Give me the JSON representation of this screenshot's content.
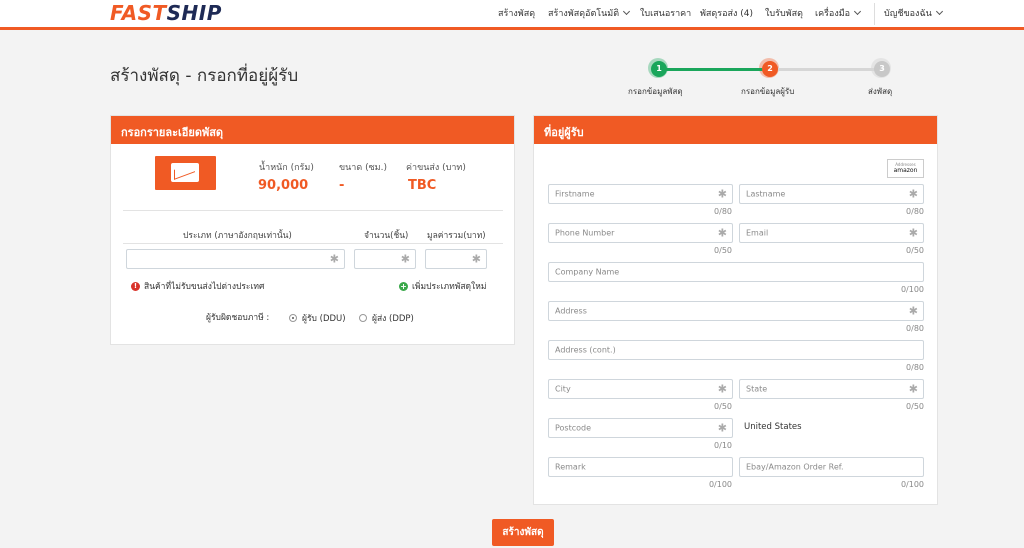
{
  "app": {
    "logo_fast": "FAST",
    "logo_ship": "SHIP"
  },
  "nav": {
    "create": "สร้างพัสดุ",
    "auto_create": "สร้างพัสดุอัตโนมัติ",
    "quotation": "ใบเสนอราคา",
    "to_ship": "พัสดุรอส่ง (4)",
    "receive": "ใบรับพัสดุ",
    "tools": "เครื่องมือ",
    "account": "บัญชีของฉัน"
  },
  "page": {
    "title": "สร้างพัสดุ - กรอกที่อยู่ผู้รับ"
  },
  "stepper": {
    "steps": [
      {
        "number": "1",
        "label": "กรอกข้อมูลพัสดุ",
        "status": "done"
      },
      {
        "number": "2",
        "label": "กรอกข้อมูลผู้รับ",
        "status": "current"
      },
      {
        "number": "3",
        "label": "ส่งพัสดุ",
        "status": "pending"
      }
    ],
    "colors": {
      "done": "#1aa65b",
      "current": "#f05a24",
      "pending": "#c8c8c8"
    }
  },
  "parcel": {
    "header": "กรอกรายละเอียดพัสดุ",
    "weight_label": "น้ำหนัก (กรัม)",
    "weight_value": "90,000",
    "size_label": "ขนาด (ซม.)",
    "size_value": "-",
    "fee_label": "ค่าขนส่ง (บาท)",
    "fee_value": "TBC",
    "col_type": "ประเภท (ภาษาอังกฤษเท่านั้น)",
    "col_qty": "จำนวน(ชิ้น)",
    "col_value": "มูลค่ารวม(บาท)",
    "restricted_note": "สินค้าที่ไม่รับขนส่งไปต่างประเทศ",
    "add_type": "เพิ่มประเภทพัสดุใหม่",
    "duty_label": "ผู้รับผิดชอบภาษี :",
    "duty_options": [
      {
        "label": "ผู้รับ (DDU)",
        "selected": true
      },
      {
        "label": "ผู้ส่ง (DDP)",
        "selected": false
      }
    ]
  },
  "recipient": {
    "header": "ที่อยู่ผู้รับ",
    "amazon_small": "Addresses",
    "amazon_label": "amazon",
    "firstname": {
      "placeholder": "Firstname",
      "counter": "0/80"
    },
    "lastname": {
      "placeholder": "Lastname",
      "counter": "0/80"
    },
    "phone": {
      "placeholder": "Phone Number",
      "counter": "0/50"
    },
    "email": {
      "placeholder": "Email",
      "counter": "0/50"
    },
    "company": {
      "placeholder": "Company Name",
      "counter": "0/100"
    },
    "address": {
      "placeholder": "Address",
      "counter": "0/80"
    },
    "address2": {
      "placeholder": "Address (cont.)",
      "counter": "0/80"
    },
    "city": {
      "placeholder": "City",
      "counter": "0/50"
    },
    "state": {
      "placeholder": "State",
      "counter": "0/50"
    },
    "postcode": {
      "placeholder": "Postcode",
      "counter": "0/10"
    },
    "country": "United States",
    "remark": {
      "placeholder": "Remark",
      "counter": "0/100"
    },
    "order_ref": {
      "placeholder": "Ebay/Amazon Order Ref.",
      "counter": "0/100"
    }
  },
  "actions": {
    "submit": "สร้างพัสดุ"
  },
  "colors": {
    "brand": "#f05a24",
    "brand_dark": "#1e2a55",
    "success": "#1aa65b"
  }
}
